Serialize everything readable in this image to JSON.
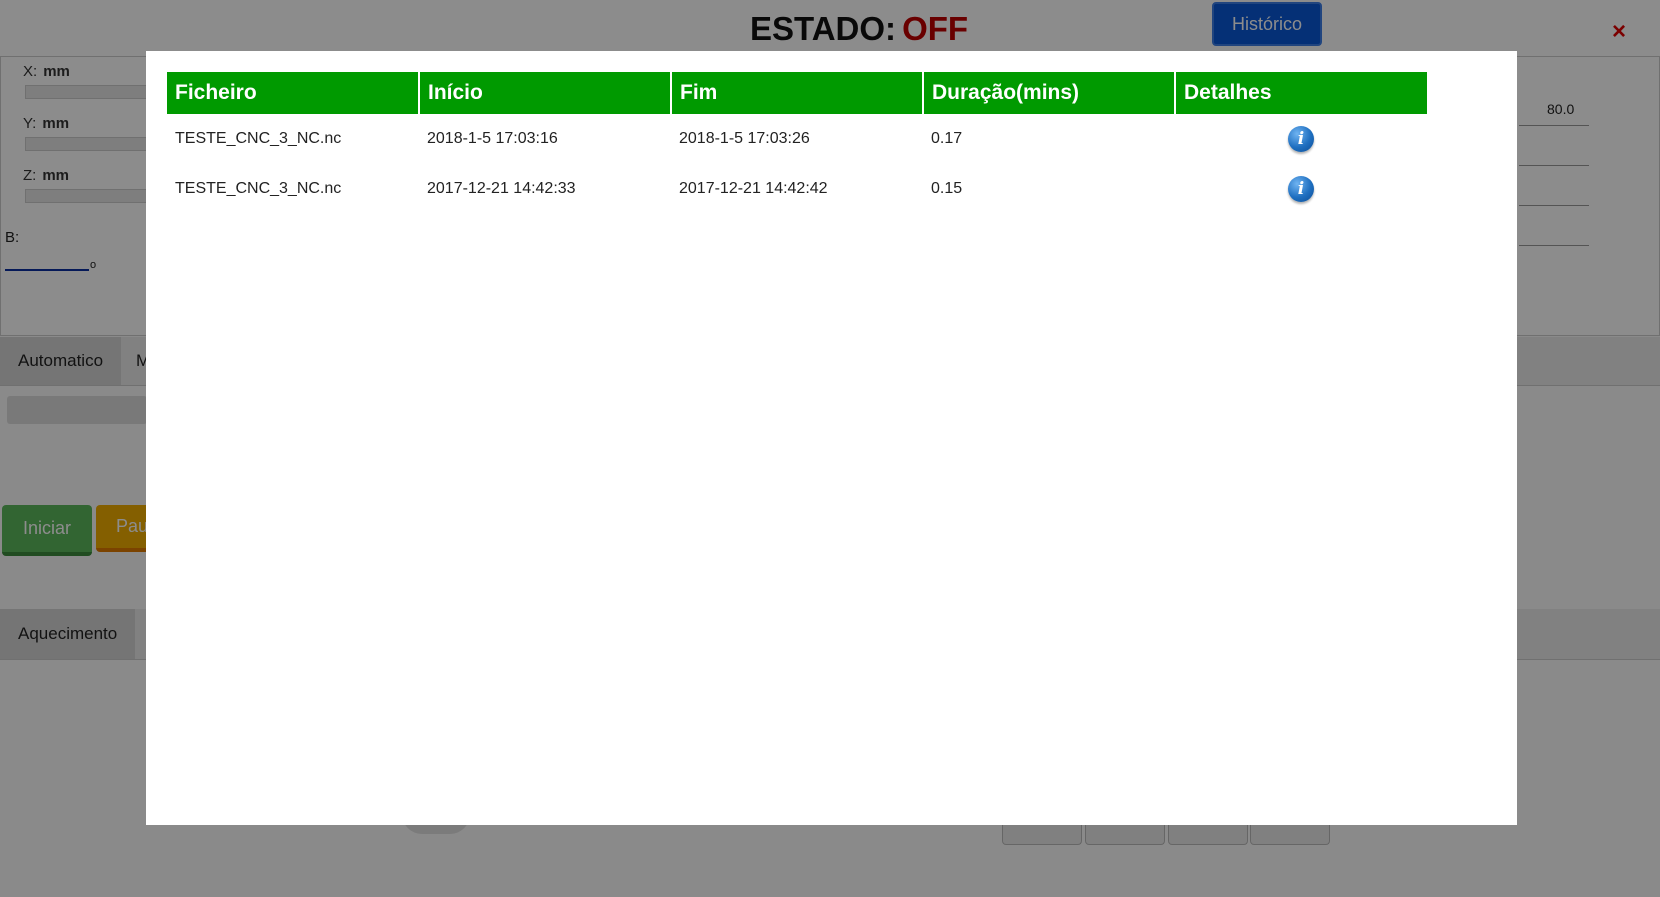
{
  "header": {
    "estado_label": "ESTADO:",
    "estado_value": "OFF",
    "historico_button": "Histórico",
    "close_glyph": "×"
  },
  "coords": {
    "x_label": "X:",
    "y_label": "Y:",
    "z_label": "Z:",
    "unit": "mm",
    "b_label": "B:",
    "b_unit": "o",
    "right_value": "80.0"
  },
  "tabs": {
    "automatico": "Automatico",
    "second_partial": "M",
    "aquecimento": "Aquecimento"
  },
  "buttons": {
    "iniciar": "Iniciar",
    "pausa_partial": "Pau"
  },
  "history": {
    "columns": [
      "Ficheiro",
      "Início",
      "Fim",
      "Duração(mins)",
      "Detalhes"
    ],
    "rows": [
      {
        "ficheiro": "TESTE_CNC_3_NC.nc",
        "inicio": "2018-1-5 17:03:16",
        "fim": "2018-1-5 17:03:26",
        "duracao": "0.17",
        "detalhes_icon": "info-icon"
      },
      {
        "ficheiro": "TESTE_CNC_3_NC.nc",
        "inicio": "2017-12-21 14:42:33",
        "fim": "2017-12-21 14:42:42",
        "duracao": "0.15",
        "detalhes_icon": "info-icon"
      }
    ]
  },
  "colors": {
    "header_green": "#009a00",
    "off_red": "#c00000",
    "historico_blue": "#0a58d8",
    "iniciar_green": "#5cb85c",
    "pausa_orange": "#f0ad00"
  }
}
